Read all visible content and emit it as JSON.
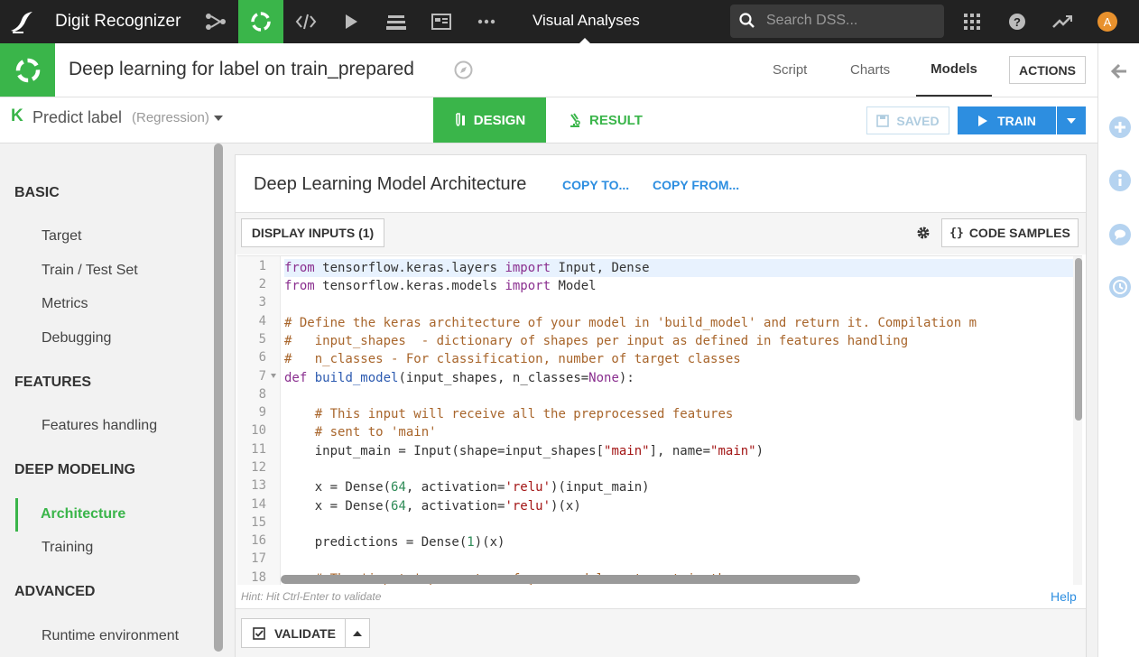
{
  "topnav": {
    "project_name": "Digit Recognizer",
    "section_label": "Visual Analyses",
    "search_placeholder": "Search DSS...",
    "avatar_initial": "A"
  },
  "header": {
    "title": "Deep learning for label on train_prepared",
    "tabs": [
      {
        "label": "Script"
      },
      {
        "label": "Charts"
      },
      {
        "label": "Models"
      }
    ],
    "active_tab": "Models",
    "actions_label": "ACTIONS"
  },
  "subheader": {
    "model_letter": "K",
    "predict_label": "Predict label",
    "task_type": "(Regression)",
    "design_label": "DESIGN",
    "result_label": "RESULT",
    "saved_label": "SAVED",
    "train_label": "TRAIN"
  },
  "sidebar": {
    "sections": [
      {
        "title": "BASIC",
        "items": [
          "Target",
          "Train / Test Set",
          "Metrics",
          "Debugging"
        ]
      },
      {
        "title": "FEATURES",
        "items": [
          "Features handling"
        ]
      },
      {
        "title": "DEEP MODELING",
        "items": [
          "Architecture",
          "Training"
        ]
      },
      {
        "title": "ADVANCED",
        "items": [
          "Runtime environment"
        ]
      }
    ],
    "active_item": "Architecture"
  },
  "panel": {
    "title": "Deep Learning Model Architecture",
    "copy_to": "COPY TO...",
    "copy_from": "COPY FROM...",
    "display_inputs": "DISPLAY INPUTS (1)",
    "code_samples": "CODE SAMPLES",
    "hint": "Hint: Hit Ctrl-Enter to validate",
    "help": "Help",
    "validate": "VALIDATE"
  },
  "code": {
    "lines": [
      "from tensorflow.keras.layers import Input, Dense",
      "from tensorflow.keras.models import Model",
      "",
      "# Define the keras architecture of your model in 'build_model' and return it. Compilation m",
      "#   input_shapes  - dictionary of shapes per input as defined in features handling",
      "#   n_classes - For classification, number of target classes",
      "def build_model(input_shapes, n_classes=None):",
      "",
      "    # This input will receive all the preprocessed features",
      "    # sent to 'main'",
      "    input_main = Input(shape=input_shapes[\"main\"], name=\"main\")",
      "",
      "    x = Dense(64, activation='relu')(input_main)",
      "    x = Dense(64, activation='relu')(x)",
      "",
      "    predictions = Dense(1)(x)",
      "",
      "    # The 'inputs' parameter of your model must contain the"
    ]
  },
  "colors": {
    "accent_green": "#3ab54a",
    "accent_blue": "#2d8ee0",
    "topnav_bg": "#222222"
  }
}
